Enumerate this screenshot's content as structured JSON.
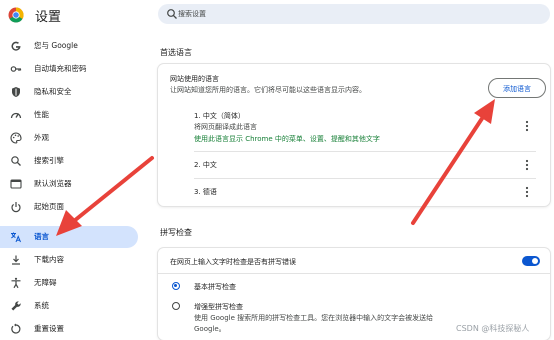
{
  "header": {
    "title": "设置",
    "search_placeholder": "搜索设置"
  },
  "sidebar": {
    "items": [
      {
        "label": "您与 Google",
        "icon": "google-icon"
      },
      {
        "label": "自动填充和密码",
        "icon": "key-icon"
      },
      {
        "label": "隐私和安全",
        "icon": "shield-icon"
      },
      {
        "label": "性能",
        "icon": "speedometer-icon"
      },
      {
        "label": "外观",
        "icon": "palette-icon"
      },
      {
        "label": "搜索引擎",
        "icon": "search-icon"
      },
      {
        "label": "默认浏览器",
        "icon": "browser-icon"
      },
      {
        "label": "起始页面",
        "icon": "power-icon"
      },
      {
        "label": "语言",
        "icon": "translate-icon",
        "active": true
      },
      {
        "label": "下载内容",
        "icon": "download-icon"
      },
      {
        "label": "无障碍",
        "icon": "accessibility-icon"
      },
      {
        "label": "系统",
        "icon": "wrench-icon"
      },
      {
        "label": "重置设置",
        "icon": "reset-icon"
      }
    ]
  },
  "languages_section": {
    "title": "首选语言",
    "card_title": "网站使用的语言",
    "card_subtitle": "让网站知道您所用的语言。它们将尽可能以这些语言显示内容。",
    "add_button": "添加语言",
    "languages": [
      {
        "label": "1. 中文（简体）",
        "detail": "将网页翻译成此语言",
        "note": "使用此语言显示 Chrome 中的菜单、设置、提醒和其他文字"
      },
      {
        "label": "2. 中文"
      },
      {
        "label": "3. 德语"
      }
    ]
  },
  "spellcheck_section": {
    "title": "拼写检查",
    "toggle_label": "在网页上输入文字时检查是否有拼写错误",
    "toggle_on": true,
    "options": [
      {
        "label": "基本拼写检查",
        "checked": true
      },
      {
        "label": "增强型拼写检查",
        "description_line1": "使用 Google 搜索所用的拼写检查工具。您在浏览器中输入的文字会被发送给",
        "description_line2": "Google。",
        "checked": false
      }
    ]
  },
  "watermark": "CSDN @科技探秘人",
  "colors": {
    "accent": "#0b57d0",
    "active_nav_bg": "#d3e3fd",
    "annotation_arrow": "#e8423a",
    "note_green": "#188038"
  }
}
